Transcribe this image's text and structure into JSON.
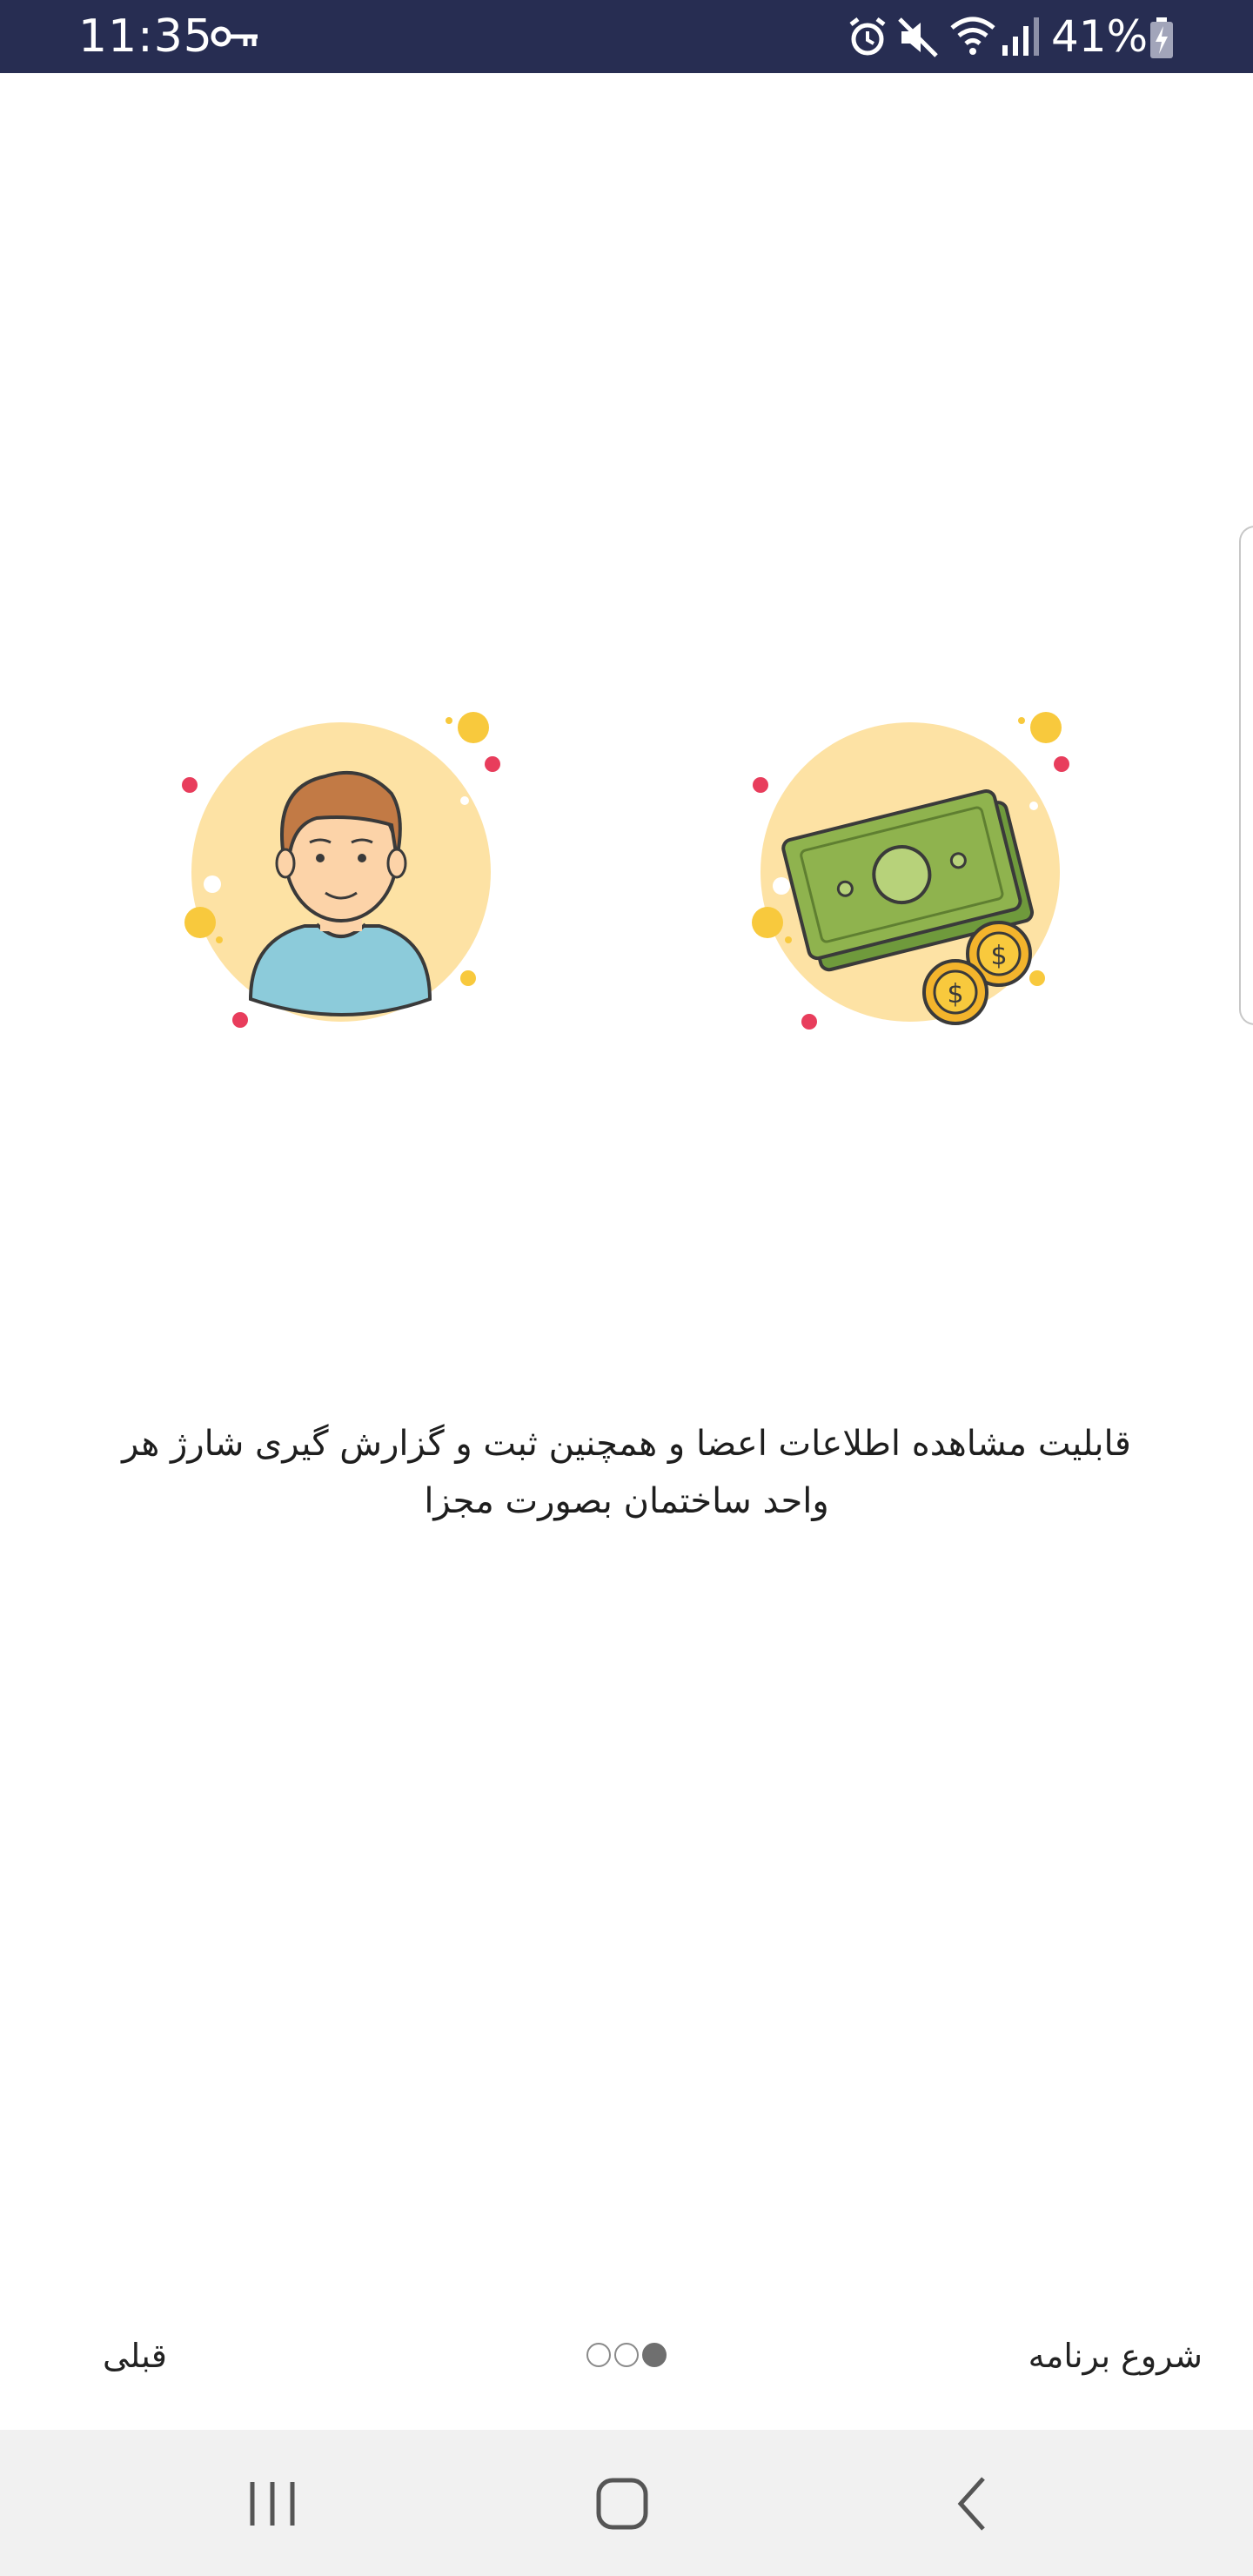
{
  "status_bar": {
    "time": "11:35",
    "battery": "41%",
    "icons": [
      "key-icon",
      "alarm-icon",
      "mute-icon",
      "wifi-icon",
      "signal-icon",
      "battery-icon"
    ]
  },
  "onboarding": {
    "description": "قابلیت مشاهده اطلاعات اعضا و همچنین ثبت و گزارش گیری شارژ هر واحد ساختمان بصورت مجزا",
    "illustrations": [
      "person-illustration",
      "money-illustration"
    ],
    "colors": {
      "circle": "#fde2a4",
      "red_dot": "#e83d5c",
      "yellow_dot": "#f8c93d",
      "money_green": "#8fb34e"
    },
    "page_indicator": {
      "total": 3,
      "active": 3
    },
    "prev_label": "قبلی",
    "start_label": "شروع برنامه"
  },
  "nav_bar": {
    "buttons": [
      "recents-icon",
      "home-icon",
      "back-icon"
    ]
  }
}
